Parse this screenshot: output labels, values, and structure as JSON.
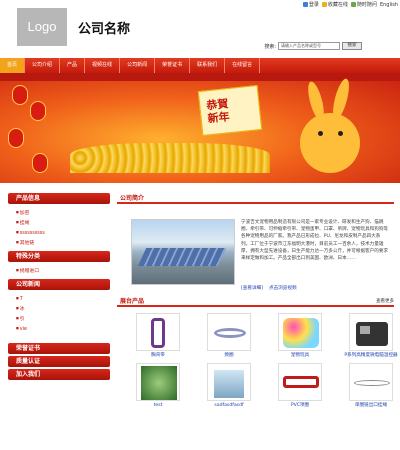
{
  "header": {
    "logo_text": "Logo",
    "company_name": "公司名称",
    "top_links": [
      "登录",
      "收藏在线",
      "随时随问",
      "English"
    ],
    "search_label": "搜索:",
    "search_placeholder": "请输入产品名称或型号",
    "search_button": "搜索"
  },
  "nav": {
    "items": [
      "首页",
      "公司介绍",
      "产品",
      "视频在线",
      "公司新闻",
      "荣誉证书",
      "联系我们",
      "在线留言"
    ],
    "active_index": 0
  },
  "banner": {
    "card_text_line1": "恭賀",
    "card_text_line2": "新年"
  },
  "sidebar": {
    "product_info_title": "产品信息",
    "product_items": [
      "加密",
      "挂绳",
      "ssssssssss",
      "其他链"
    ],
    "special_title": "特殊分类",
    "special_items": [
      "捐赠进口"
    ],
    "news_title": "公司新闻",
    "news_items": [
      "7",
      "冰",
      "引",
      "vie"
    ],
    "honor_title": "荣誉证书",
    "quality_title": "质量认证",
    "join_title": "加入我们"
  },
  "about": {
    "title": "公司简介",
    "text": "宁波吉文宠物用品制造有限公司是一家专业设计、研发和生产狗、猫跳圈、牵引带、可伸缩牵引带、宠物蛋甲、口罩、吊牌、宠物玩具和狗狗等各种宠物用品的厂家。我产品已形成拉、PU、尼龙和皮制产品四大系列。工厂位于宁波市江东福明大港时，目前员工一百余人，技术力量雄厚，拥有大型先进设备，日生产能力达一万多公斤，并可根据客户的要求来样定做和加工。产品全部出口到美国、欧洲、日本……",
    "more_link": "[查看详细]",
    "online_link": "点击浏览视频"
  },
  "products": {
    "title": "展台产品",
    "more": "查看更多",
    "items": [
      {
        "label": "胸背带"
      },
      {
        "label": "颈圈"
      },
      {
        "label": "宠物玩具"
      },
      {
        "label": "P系列高精度微电脑温控器"
      },
      {
        "label": "test"
      },
      {
        "label": "sadfasdfasdf"
      },
      {
        "label": "PVC项圈"
      },
      {
        "label": "单圈链出口挂绳"
      }
    ]
  },
  "colors": {
    "brand_red": "#c41a0c",
    "nav_active": "#f2a31a",
    "link_blue": "#1a3fb0"
  }
}
